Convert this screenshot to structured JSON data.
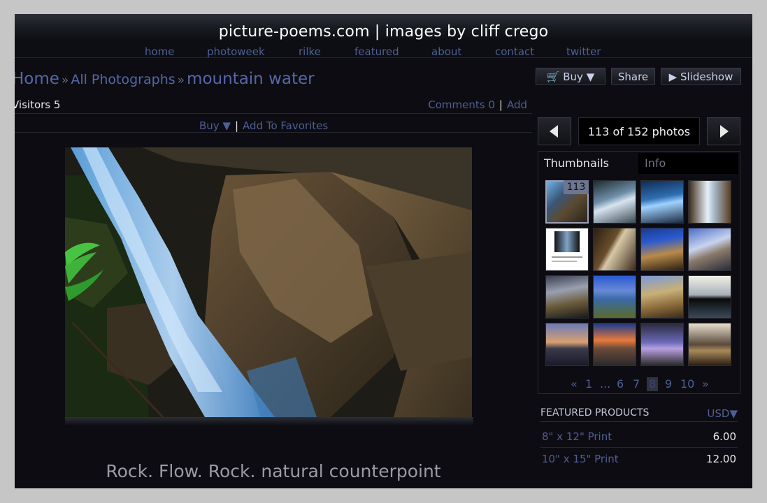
{
  "site": {
    "title": "picture-poems.com | images by cliff crego"
  },
  "nav": [
    {
      "label": "home"
    },
    {
      "label": "photoweek"
    },
    {
      "label": "rilke"
    },
    {
      "label": "featured"
    },
    {
      "label": "about"
    },
    {
      "label": "contact"
    },
    {
      "label": "twitter"
    }
  ],
  "breadcrumb": {
    "home": "Home",
    "sep": "»",
    "gallery": "All Photographs",
    "current": "mountain water"
  },
  "stats": {
    "visitors": "Visitors 5",
    "comments": "Comments 0",
    "add": "Add"
  },
  "actions": {
    "buy": "Buy ▼",
    "favorites": "Add To Favorites"
  },
  "photo": {
    "caption": "Rock. Flow. Rock. natural counterpoint"
  },
  "toolbar": {
    "buy": "Buy",
    "share": "Share",
    "slideshow": "Slideshow"
  },
  "counter": {
    "text": "113 of 152 photos",
    "current": 113,
    "total": 152
  },
  "tabs": {
    "thumbnails": "Thumbnails",
    "info": "Info"
  },
  "thumbs": {
    "badge": "113",
    "selected_index": 0,
    "count": 16
  },
  "pager": {
    "prev": "«",
    "next": "»",
    "ellipsis": "...",
    "pages": [
      "1",
      "6",
      "7",
      "8",
      "9",
      "10"
    ],
    "current": "8"
  },
  "featured": {
    "title": "FEATURED PRODUCTS",
    "currency": "USD▼",
    "products": [
      {
        "name": "8\" x 12\" Print",
        "price": "6.00"
      },
      {
        "name": "10\" x 15\" Print",
        "price": "12.00"
      }
    ]
  },
  "colors": {
    "link": "#4f5f95",
    "background": "#0c0c12",
    "page_bg": "#c6c6c6"
  }
}
